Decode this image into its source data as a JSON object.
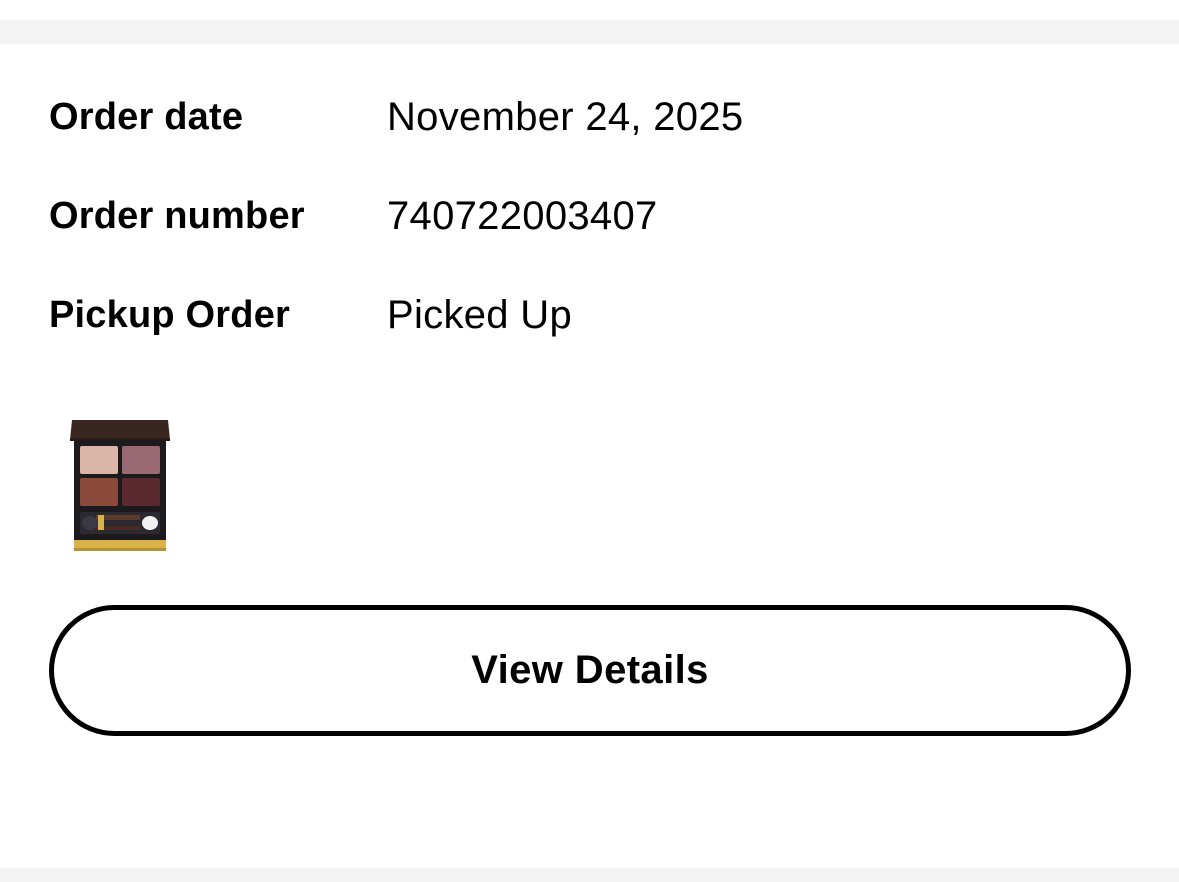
{
  "order": {
    "date_label": "Order date",
    "date_value": "November 24, 2025",
    "number_label": "Order number",
    "number_value": "740722003407",
    "pickup_label": "Pickup Order",
    "pickup_value": "Picked Up"
  },
  "product": {
    "icon": "eyeshadow-palette-thumbnail",
    "colors": {
      "lid": "#3a2620",
      "case": "#1c1a1c",
      "shade_1": "#d9b6a8",
      "shade_2": "#9a6a74",
      "shade_3": "#8a4a3c",
      "shade_4": "#5a2a30",
      "gold": "#d8b24a"
    }
  },
  "actions": {
    "view_details_label": "View Details"
  },
  "colors": {
    "background": "#ffffff",
    "separator": "#f4f4f4",
    "text": "#000000",
    "button_border": "#000000"
  }
}
